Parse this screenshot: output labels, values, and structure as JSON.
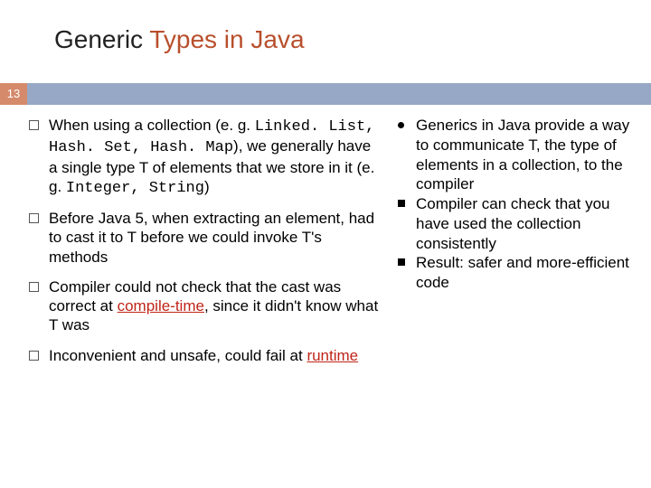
{
  "title_plain": "Generic ",
  "title_hl": "Types in Java",
  "page_number": "13",
  "left": {
    "b1_a": "When using a collection (e. g. ",
    "b1_code1": "Linked. List, Hash. Set, Hash. Map",
    "b1_b": "), we generally have a single type T of elements that we store in it (e. g. ",
    "b1_code2": "Integer, String",
    "b1_c": ")",
    "b2": "Before Java 5, when extracting an element, had to cast it to T before we could invoke T's methods",
    "b3_a": "Compiler could not check that the cast was correct at ",
    "b3_ct": "compile-time",
    "b3_b": ", since it didn't know what T was",
    "b4_a": "Inconvenient and unsafe, could fail at ",
    "b4_rt": "runtime"
  },
  "right": {
    "r1": "Generics in Java provide a way to communicate T, the type of elements in a collection, to the compiler",
    "r2": "Compiler can check that you have used the collection consistently",
    "r3": "Result: safer and more-efficient code"
  },
  "chart_data": {
    "type": "table",
    "title": "Generic Types in Java",
    "series": [
      {
        "name": "left_bullets",
        "values": [
          "When using a collection (e.g. LinkedList, HashSet, HashMap), we generally have a single type T of elements that we store in it (e.g. Integer, String)",
          "Before Java 5, when extracting an element, had to cast it to T before we could invoke T's methods",
          "Compiler could not check that the cast was correct at compile-time, since it didn't know what T was",
          "Inconvenient and unsafe, could fail at runtime"
        ]
      },
      {
        "name": "right_bullets",
        "values": [
          "Generics in Java provide a way to communicate T, the type of elements in a collection, to the compiler",
          "Compiler can check that you have used the collection consistently",
          "Result: safer and more-efficient code"
        ]
      }
    ]
  }
}
